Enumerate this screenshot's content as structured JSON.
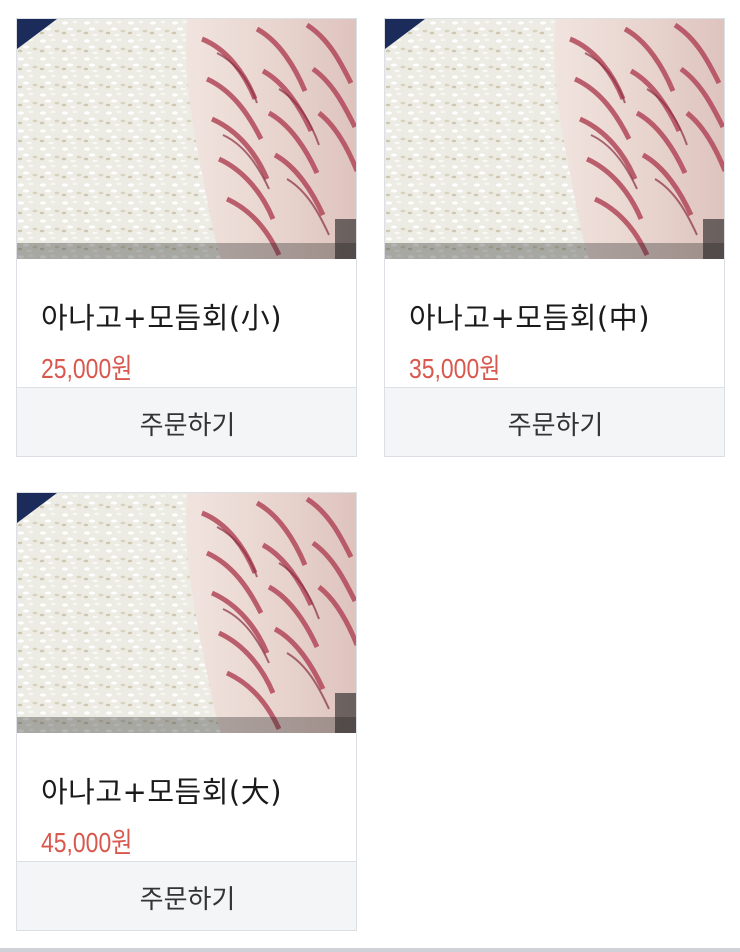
{
  "products": [
    {
      "name": "아나고+모듬회(小)",
      "price": "25,000원",
      "order_label": "주문하기"
    },
    {
      "name": "아나고+모듬회(中)",
      "price": "35,000원",
      "order_label": "주문하기"
    },
    {
      "name": "아나고+모듬회(大)",
      "price": "45,000원",
      "order_label": "주문하기"
    }
  ],
  "colors": {
    "price": "#d9584e",
    "order_bg": "#f4f5f7",
    "border": "#dcdfe3"
  }
}
